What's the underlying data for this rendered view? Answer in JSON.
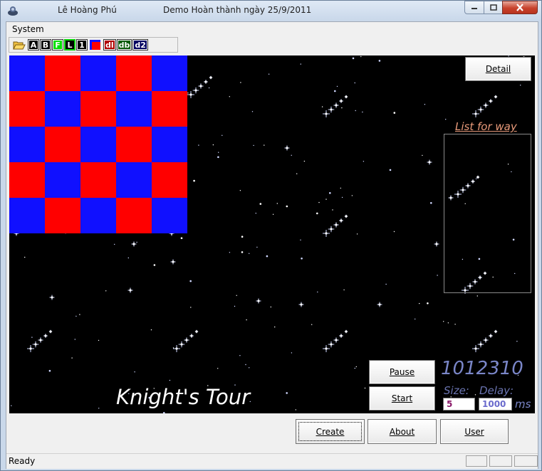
{
  "window": {
    "author": "Lê Hoàng Phú",
    "title": "Demo Hoàn thành ngày 25/9/2011"
  },
  "menu": {
    "system": "System"
  },
  "toolbar": {
    "buttons": [
      {
        "id": "open",
        "label": "",
        "icon": "folder-open-icon"
      },
      {
        "id": "a",
        "label": "A"
      },
      {
        "id": "b",
        "label": "B"
      },
      {
        "id": "f",
        "label": "F"
      },
      {
        "id": "l",
        "label": "L"
      },
      {
        "id": "one",
        "label": "1"
      },
      {
        "id": "color",
        "label": "",
        "icon": "color-square-icon"
      },
      {
        "id": "dl",
        "label": "dl"
      },
      {
        "id": "db",
        "label": "db"
      },
      {
        "id": "d2",
        "label": "d2"
      }
    ]
  },
  "board": {
    "size": 5,
    "colors": {
      "light": "#1010ff",
      "dark": "#ff0000"
    }
  },
  "panel": {
    "detail_label": "Detail",
    "list_title": "List for way",
    "pause_label": "Pause",
    "start_label": "Start",
    "counter": "1012310",
    "size_label": "Size:",
    "delay_label": "Delay:",
    "size_value": "5",
    "delay_value": "1000",
    "ms_label": "ms",
    "app_title": "Knight's Tour"
  },
  "bottom": {
    "create_label": "Create",
    "about_label": "About",
    "user_label": "User"
  },
  "status": {
    "text": "Ready"
  }
}
